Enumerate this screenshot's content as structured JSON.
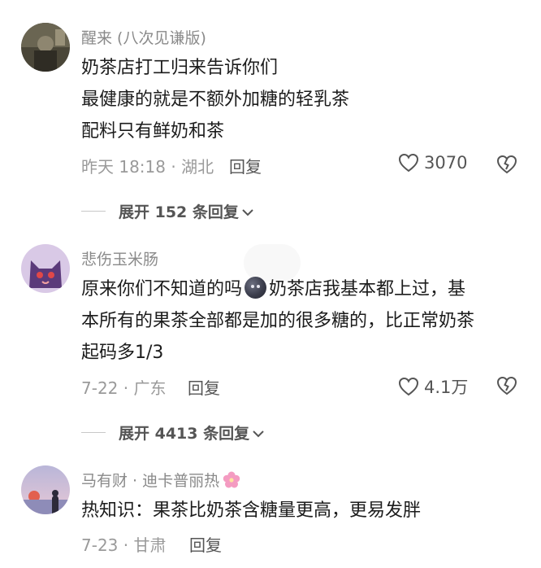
{
  "comments": [
    {
      "username": "醒来 (八次见谦版)",
      "lines": [
        "奶茶店打工归来告诉你们",
        "最健康的就是不额外加糖的轻乳茶",
        "配料只有鲜奶和茶"
      ],
      "time_location": "昨天 18:18 · 湖北",
      "reply_label": "回复",
      "likes": "3070",
      "expand_label": "展开 152 条回复"
    },
    {
      "username": "悲伤玉米肠",
      "line1_before_emoji": "原来你们不知道的吗",
      "line1_after_emoji": "奶茶店我基本都上过，基",
      "line2": "本所有的果茶全部都是加的很多糖的，比正常奶茶",
      "line3": "起码多1/3",
      "time_location": "7-22 · 广东",
      "reply_label": "回复",
      "likes": "4.1万",
      "expand_label": "展开 4413 条回复"
    },
    {
      "username": "马有财 · 迪卡普丽热",
      "lines": [
        "热知识：果茶比奶茶含糖量更高，更易发胖"
      ],
      "time_location": "7-23 · 甘肃",
      "reply_label": "回复"
    }
  ],
  "icons": {
    "like": "heart-icon",
    "dislike": "broken-heart-icon",
    "expand": "chevron-down-icon",
    "inline_emoji": "dark-face-emoji",
    "flower": "cherry-blossom-icon"
  }
}
